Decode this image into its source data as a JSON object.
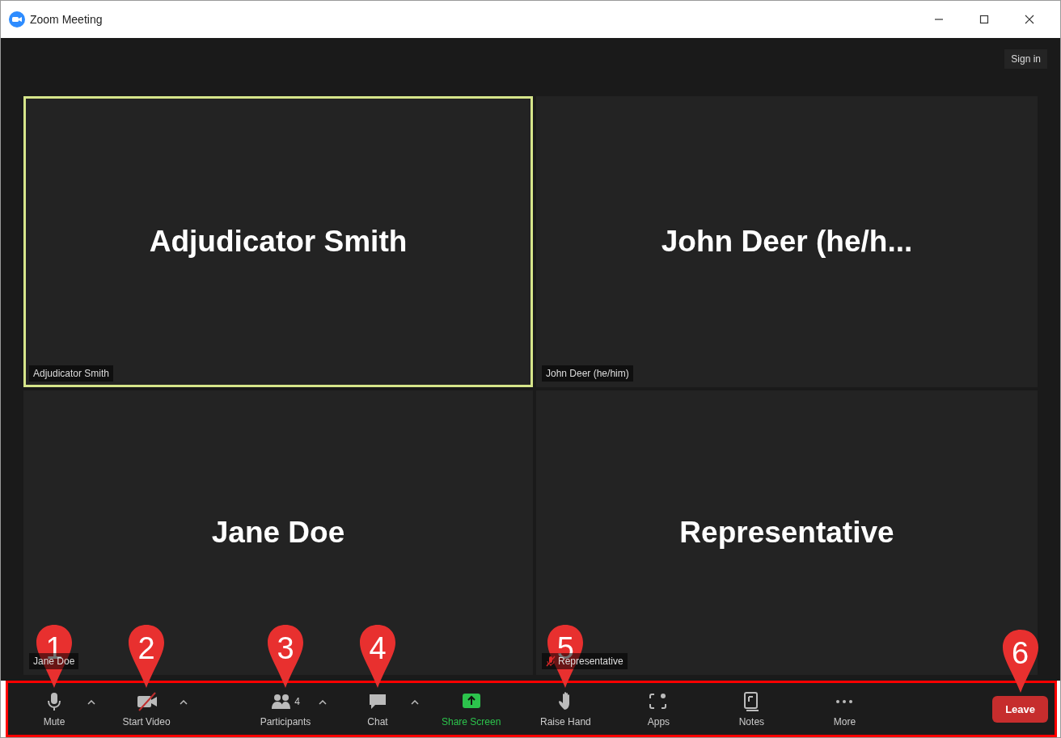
{
  "window": {
    "title": "Zoom Meeting"
  },
  "sign_in": "Sign in",
  "tiles": [
    {
      "name": "Adjudicator Smith",
      "label": "Adjudicator Smith",
      "active_speaker": true,
      "muted": false
    },
    {
      "name": "John Deer (he/h...",
      "label": "John Deer (he/him)",
      "active_speaker": false,
      "muted": false
    },
    {
      "name": "Jane Doe",
      "label": "Jane Doe",
      "active_speaker": false,
      "muted": false
    },
    {
      "name": "Representative",
      "label": "Representative",
      "active_speaker": false,
      "muted": true
    }
  ],
  "toolbar": [
    {
      "kind": "mute",
      "label": "Mute",
      "caret": true,
      "marker": "1"
    },
    {
      "kind": "video",
      "label": "Start Video",
      "caret": true,
      "marker": "2"
    },
    {
      "kind": "participants",
      "label": "Participants",
      "count": "4",
      "caret": true,
      "marker": "3"
    },
    {
      "kind": "chat",
      "label": "Chat",
      "caret": true,
      "marker": "4"
    },
    {
      "kind": "share",
      "label": "Share Screen",
      "caret": false
    },
    {
      "kind": "hand",
      "label": "Raise Hand",
      "caret": false,
      "marker": "5"
    },
    {
      "kind": "apps",
      "label": "Apps",
      "caret": false
    },
    {
      "kind": "notes",
      "label": "Notes",
      "caret": false
    },
    {
      "kind": "more",
      "label": "More",
      "caret": false
    }
  ],
  "leave": {
    "label": "Leave",
    "marker": "6"
  }
}
